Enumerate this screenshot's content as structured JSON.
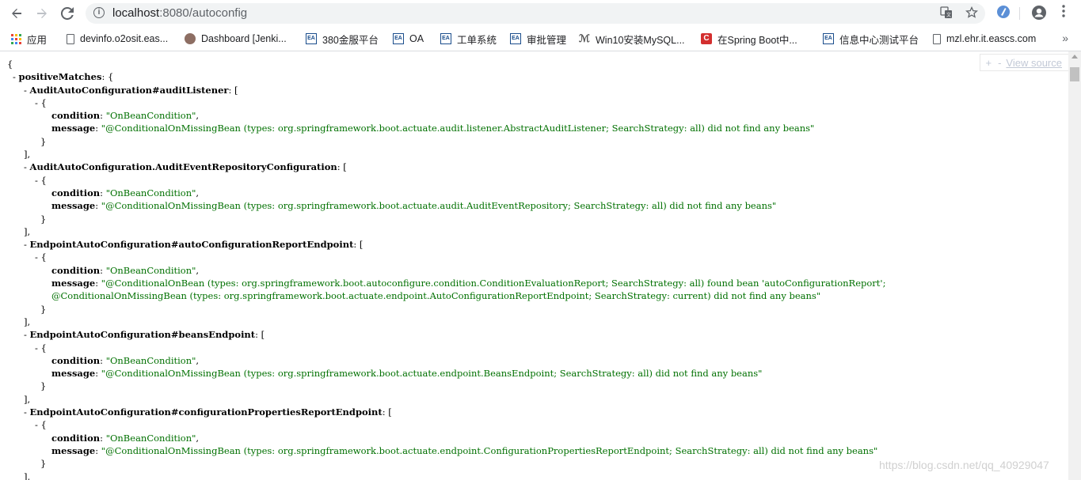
{
  "browser": {
    "url_host": "localhost",
    "url_rest": ":8080/autoconfig",
    "bookmarks": [
      {
        "label": "应用",
        "icon": "apps-icon"
      },
      {
        "label": "devinfo.o2osit.eas...",
        "icon": "page-icon"
      },
      {
        "label": "Dashboard [Jenki...",
        "icon": "jenkins-icon"
      },
      {
        "label": "380金服平台",
        "icon": "ea-icon"
      },
      {
        "label": "OA",
        "icon": "ea-icon"
      },
      {
        "label": "工单系统",
        "icon": "ea-icon"
      },
      {
        "label": "审批管理",
        "icon": "ea-icon"
      },
      {
        "label": "Win10安装MySQL...",
        "icon": "logo-icon"
      },
      {
        "label": "在Spring Boot中...",
        "icon": "csdn-icon"
      },
      {
        "label": "信息中心测试平台",
        "icon": "ea-icon"
      },
      {
        "label": "mzl.ehr.it.eascs.com",
        "icon": "page-icon"
      }
    ],
    "more_label": "»"
  },
  "viewer": {
    "expand_label": "+",
    "collapse_label": "-",
    "view_source_label": "View source"
  },
  "json_lines": [
    {
      "indent": 0,
      "parts": [
        {
          "t": "{",
          "c": "p"
        }
      ]
    },
    {
      "indent": 1,
      "parts": [
        {
          "t": "- ",
          "c": "toggle"
        },
        {
          "t": "positiveMatches",
          "c": "key"
        },
        {
          "t": ": {",
          "c": "p"
        }
      ]
    },
    {
      "indent": 3,
      "parts": [
        {
          "t": "- ",
          "c": "toggle"
        },
        {
          "t": "AuditAutoConfiguration#auditListener",
          "c": "key"
        },
        {
          "t": ": [",
          "c": "p"
        }
      ]
    },
    {
      "indent": 5,
      "parts": [
        {
          "t": "- {",
          "c": "toggle"
        }
      ]
    },
    {
      "indent": 8,
      "parts": [
        {
          "t": "condition",
          "c": "key"
        },
        {
          "t": ": ",
          "c": "p"
        },
        {
          "t": "\"OnBeanCondition\"",
          "c": "str"
        },
        {
          "t": ",",
          "c": "p"
        }
      ]
    },
    {
      "indent": 8,
      "parts": [
        {
          "t": "message",
          "c": "key"
        },
        {
          "t": ": ",
          "c": "p"
        },
        {
          "t": "\"@ConditionalOnMissingBean (types: org.springframework.boot.actuate.audit.listener.AbstractAuditListener; SearchStrategy: all) did not find any beans\"",
          "c": "str"
        }
      ]
    },
    {
      "indent": 6,
      "parts": [
        {
          "t": "}",
          "c": "p"
        }
      ]
    },
    {
      "indent": 3,
      "parts": [
        {
          "t": "],",
          "c": "p"
        }
      ]
    },
    {
      "indent": 3,
      "parts": [
        {
          "t": "- ",
          "c": "toggle"
        },
        {
          "t": "AuditAutoConfiguration.AuditEventRepositoryConfiguration",
          "c": "key"
        },
        {
          "t": ": [",
          "c": "p"
        }
      ]
    },
    {
      "indent": 5,
      "parts": [
        {
          "t": "- {",
          "c": "toggle"
        }
      ]
    },
    {
      "indent": 8,
      "parts": [
        {
          "t": "condition",
          "c": "key"
        },
        {
          "t": ": ",
          "c": "p"
        },
        {
          "t": "\"OnBeanCondition\"",
          "c": "str"
        },
        {
          "t": ",",
          "c": "p"
        }
      ]
    },
    {
      "indent": 8,
      "parts": [
        {
          "t": "message",
          "c": "key"
        },
        {
          "t": ": ",
          "c": "p"
        },
        {
          "t": "\"@ConditionalOnMissingBean (types: org.springframework.boot.actuate.audit.AuditEventRepository; SearchStrategy: all) did not find any beans\"",
          "c": "str"
        }
      ]
    },
    {
      "indent": 6,
      "parts": [
        {
          "t": "}",
          "c": "p"
        }
      ]
    },
    {
      "indent": 3,
      "parts": [
        {
          "t": "],",
          "c": "p"
        }
      ]
    },
    {
      "indent": 3,
      "parts": [
        {
          "t": "- ",
          "c": "toggle"
        },
        {
          "t": "EndpointAutoConfiguration#autoConfigurationReportEndpoint",
          "c": "key"
        },
        {
          "t": ": [",
          "c": "p"
        }
      ]
    },
    {
      "indent": 5,
      "parts": [
        {
          "t": "- {",
          "c": "toggle"
        }
      ]
    },
    {
      "indent": 8,
      "parts": [
        {
          "t": "condition",
          "c": "key"
        },
        {
          "t": ": ",
          "c": "p"
        },
        {
          "t": "\"OnBeanCondition\"",
          "c": "str"
        },
        {
          "t": ",",
          "c": "p"
        }
      ]
    },
    {
      "indent": 8,
      "parts": [
        {
          "t": "message",
          "c": "key"
        },
        {
          "t": ": ",
          "c": "p"
        },
        {
          "t": "\"@ConditionalOnBean (types: org.springframework.boot.autoconfigure.condition.ConditionEvaluationReport; SearchStrategy: all) found bean 'autoConfigurationReport';",
          "c": "str"
        }
      ]
    },
    {
      "indent": 8,
      "parts": [
        {
          "t": "@ConditionalOnMissingBean (types: org.springframework.boot.actuate.endpoint.AutoConfigurationReportEndpoint; SearchStrategy: current) did not find any beans\"",
          "c": "str"
        }
      ]
    },
    {
      "indent": 6,
      "parts": [
        {
          "t": "}",
          "c": "p"
        }
      ]
    },
    {
      "indent": 3,
      "parts": [
        {
          "t": "],",
          "c": "p"
        }
      ]
    },
    {
      "indent": 3,
      "parts": [
        {
          "t": "- ",
          "c": "toggle"
        },
        {
          "t": "EndpointAutoConfiguration#beansEndpoint",
          "c": "key"
        },
        {
          "t": ": [",
          "c": "p"
        }
      ]
    },
    {
      "indent": 5,
      "parts": [
        {
          "t": "- {",
          "c": "toggle"
        }
      ]
    },
    {
      "indent": 8,
      "parts": [
        {
          "t": "condition",
          "c": "key"
        },
        {
          "t": ": ",
          "c": "p"
        },
        {
          "t": "\"OnBeanCondition\"",
          "c": "str"
        },
        {
          "t": ",",
          "c": "p"
        }
      ]
    },
    {
      "indent": 8,
      "parts": [
        {
          "t": "message",
          "c": "key"
        },
        {
          "t": ": ",
          "c": "p"
        },
        {
          "t": "\"@ConditionalOnMissingBean (types: org.springframework.boot.actuate.endpoint.BeansEndpoint; SearchStrategy: all) did not find any beans\"",
          "c": "str"
        }
      ]
    },
    {
      "indent": 6,
      "parts": [
        {
          "t": "}",
          "c": "p"
        }
      ]
    },
    {
      "indent": 3,
      "parts": [
        {
          "t": "],",
          "c": "p"
        }
      ]
    },
    {
      "indent": 3,
      "parts": [
        {
          "t": "- ",
          "c": "toggle"
        },
        {
          "t": "EndpointAutoConfiguration#configurationPropertiesReportEndpoint",
          "c": "key"
        },
        {
          "t": ": [",
          "c": "p"
        }
      ]
    },
    {
      "indent": 5,
      "parts": [
        {
          "t": "- {",
          "c": "toggle"
        }
      ]
    },
    {
      "indent": 8,
      "parts": [
        {
          "t": "condition",
          "c": "key"
        },
        {
          "t": ": ",
          "c": "p"
        },
        {
          "t": "\"OnBeanCondition\"",
          "c": "str"
        },
        {
          "t": ",",
          "c": "p"
        }
      ]
    },
    {
      "indent": 8,
      "parts": [
        {
          "t": "message",
          "c": "key"
        },
        {
          "t": ": ",
          "c": "p"
        },
        {
          "t": "\"@ConditionalOnMissingBean (types: org.springframework.boot.actuate.endpoint.ConfigurationPropertiesReportEndpoint; SearchStrategy: all) did not find any beans\"",
          "c": "str"
        }
      ]
    },
    {
      "indent": 6,
      "parts": [
        {
          "t": "}",
          "c": "p"
        }
      ]
    },
    {
      "indent": 3,
      "parts": [
        {
          "t": "],",
          "c": "p"
        }
      ]
    }
  ],
  "watermark": "https://blog.csdn.net/qq_40929047"
}
